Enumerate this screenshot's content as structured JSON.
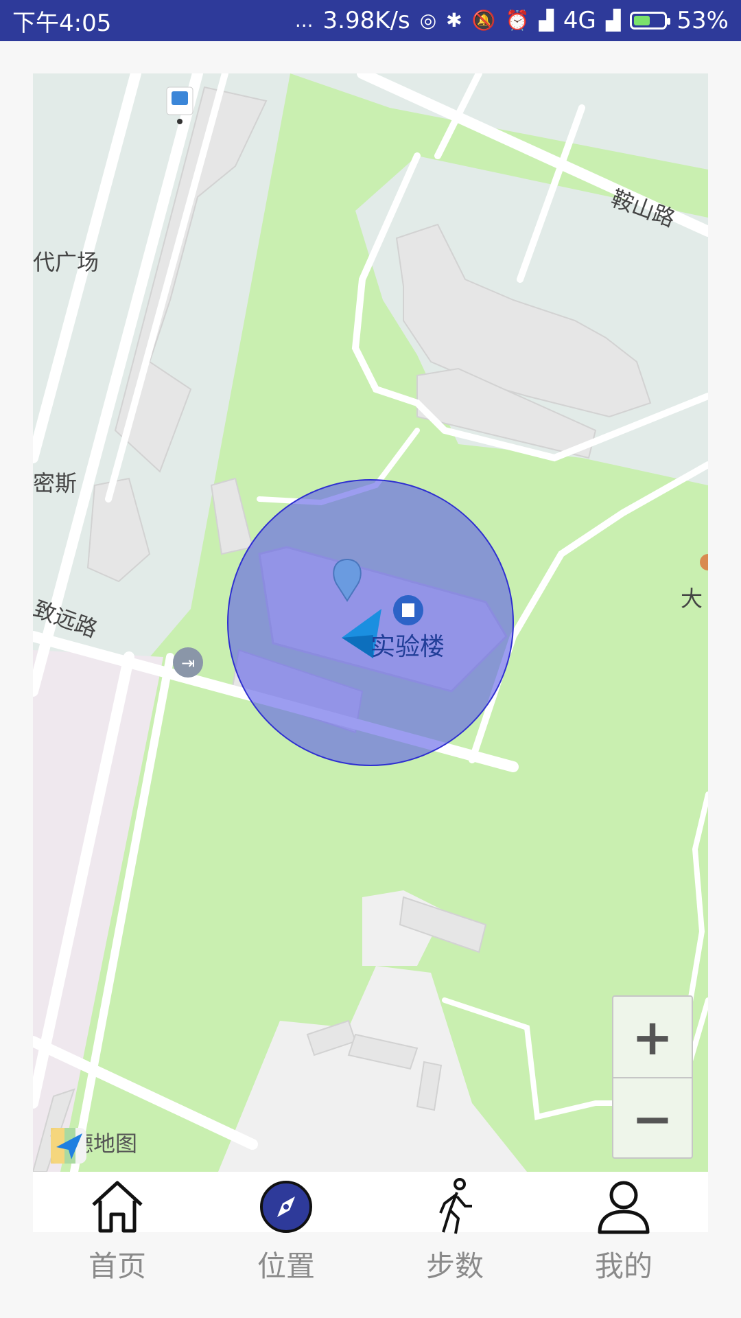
{
  "status_bar": {
    "time": "下午4:05",
    "dots": "...",
    "net_speed": "3.98K/s",
    "network": "4G",
    "battery_percent": "53%",
    "battery_level": 0.53,
    "icons": [
      "hotspot-icon",
      "bluetooth-icon",
      "mute-icon",
      "alarm-icon",
      "signal-icon",
      "signal-icon",
      "battery-icon"
    ]
  },
  "map": {
    "labels": {
      "road_anshan": "鞍山路",
      "square": "代广场",
      "mis": "密斯",
      "zhiyuan": "致远路",
      "big": "大",
      "poi_name": "实验楼"
    },
    "logo_text": "高德地图",
    "zoom_in": "+",
    "zoom_out": "−",
    "colors": {
      "green": "#c9efb0",
      "block": "#e2ebe8",
      "building": "#e6e6e6",
      "road": "#ffffff",
      "accuracy_circle": "#5f61e6",
      "marker": "#5d8fd6",
      "location_arrow": "#1b8fe0"
    }
  },
  "nav": {
    "items": [
      {
        "label": "首页",
        "icon": "home-icon",
        "active": false
      },
      {
        "label": "位置",
        "icon": "compass-icon",
        "active": true
      },
      {
        "label": "步数",
        "icon": "walking-icon",
        "active": false
      },
      {
        "label": "我的",
        "icon": "user-icon",
        "active": false
      }
    ]
  }
}
